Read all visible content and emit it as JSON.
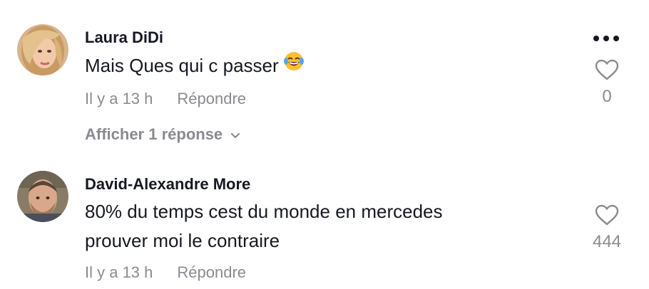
{
  "comments": [
    {
      "username": "Laura DiDi",
      "text": "Mais Ques qui c passer",
      "time": "Il y a 13 h",
      "reply_label": "Répondre",
      "likes": "0",
      "view_replies": "Afficher 1 réponse",
      "emoji": "face-with-tears-of-joy"
    },
    {
      "username": "David-Alexandre More",
      "text_line1": "80% du temps cest du monde en mercedes",
      "text_line2": "prouver moi le contraire",
      "time": "Il y a 13 h",
      "reply_label": "Répondre",
      "likes": "444"
    }
  ],
  "icons": {
    "more": "more-horizontal-icon",
    "like": "heart-outline-icon",
    "chevron": "chevron-down-icon"
  },
  "colors": {
    "text_primary": "#161823",
    "text_secondary": "#8a8b91"
  }
}
